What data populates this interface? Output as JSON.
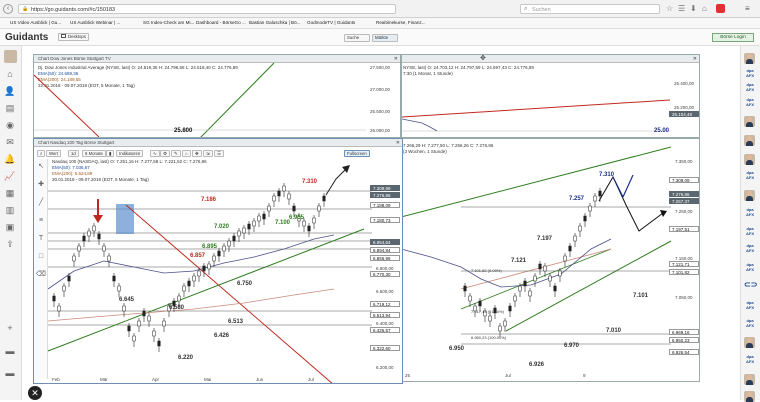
{
  "browser": {
    "url": "https://go.guidants.com/#c/150183",
    "search_placeholder": "Suchen",
    "bookmarks": [
      "US Video Ausblick | Gu...",
      "US Ausblick Webinar | ...",
      "SG Index-Check am Mi...",
      "Dashboard - BörseGo ...",
      "Bastian Galuschka | Bö...",
      "GodmodeTV | Guidants",
      "Realtimekurse, Finanz..."
    ]
  },
  "app": {
    "logo": "Guidants",
    "desktop_btn": "Desktops",
    "search_btn": "Suche",
    "market_btn": "Märkte",
    "login_btn": "Börse Login"
  },
  "win_dow": {
    "title": "Chart Dow Jones Börse Stuttgart TV",
    "info1": "Dj. Dow Jones Industrial Average (NYSE, last)  O: 24.519,35  H: 24.796,56  L: 24.518,40  C: 24.776,89",
    "info2": "EMA(50): 24.689,36",
    "info3": "EMA(200): 24.189,55",
    "info4": "22.01.2018 - 09.07.2018  (EOT, 5 Monate, 1 Tag)",
    "axis": [
      "27.500,00",
      "27.000,00",
      "26.500,00",
      "26.000,00"
    ],
    "label": "25.800"
  },
  "win_nyse": {
    "info1": "NYSE, last)  O: 24.703,12  H: 24.797,59  L: 24.697,43  C: 24.776,89",
    "info2": "7:30   (1 Monat, 1 Stunde)",
    "axis": [
      "25.400,00",
      "25.200,00"
    ],
    "price1": "25.104,48",
    "label": "25.00"
  },
  "win_ndx": {
    "title": "Chart Nasdaq 100 Tag Börse Stuttgart",
    "info1": "Nasdaq 100 (NASDAQ, last)  O: 7.251,16  H: 7.277,58  L: 7.221,52  C: 7.276,86",
    "info2": "EMA(50): 7.036,67",
    "info3": "EMA(200): 6.624,89",
    "info4": "30.01.2018 - 09.07.2018  (EOT, 5 Monate, 1 Tag)",
    "toolbar": [
      "Wert",
      "1d",
      "6 Monate",
      "Indikatoren",
      "Fullscreen"
    ],
    "prices": [
      "7.309,99",
      "7.276,86",
      "7.188,09",
      "7.180,73",
      "6.954,64",
      "6.894,84",
      "6.856,96",
      "6.770,30",
      "6.719,12",
      "6.513,94",
      "6.426,57",
      "6.322,60"
    ],
    "axis": [
      "7.000,00",
      "6.800,00",
      "6.600,00",
      "6.400,00",
      "6.200,00"
    ],
    "months": [
      "Feb",
      "Mär",
      "Apr",
      "Mai",
      "Jun",
      "Jul"
    ],
    "labels": [
      "7.310",
      "7.186",
      "7.100",
      "7.020",
      "6.955",
      "6.895",
      "6.857",
      "6.750",
      "6.645",
      "6.580",
      "6.513",
      "6.426",
      "6.220"
    ]
  },
  "win_ndx_h": {
    "info1": "7.266,29  H: 7.277,50  L: 7.256,26  C: 7.276,86",
    "info2": "(3 Wochen, 1 Stunde)",
    "prices": [
      "7.309,09",
      "7.276,86",
      "7.257,37",
      "7.197,51",
      "7.121,71",
      "7.101,82",
      "6.969,16",
      "6.950,23",
      "6.926,54"
    ],
    "axis": [
      "7.350,00",
      "7.250,00",
      "7.150,00",
      "7.050,00",
      "6.950,00"
    ],
    "months": [
      "25",
      "Jul",
      "9"
    ],
    "labels": [
      "7.310",
      "7.257",
      "7.197",
      "7.121",
      "7.101",
      "7.010",
      "6.970",
      "6.950",
      "6.926"
    ],
    "fib1": "7.101,82 (0.00%)",
    "fib2": "7.017,14 (61.80%)",
    "fib3": "6.950,23 (100.00%)"
  },
  "colors": {
    "accent": "#2a6db0",
    "red_line": "#c0281e",
    "green_line": "#2f7d1f",
    "price_dark": "#5b6770"
  }
}
